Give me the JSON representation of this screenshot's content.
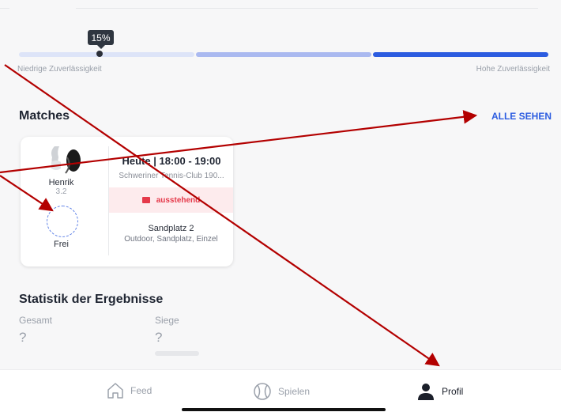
{
  "reliability": {
    "badge": "15%",
    "progress_percent": 15,
    "low_label": "Niedrige Zuverlässigkeit",
    "high_label": "Hohe Zuverlässigkeit"
  },
  "matches": {
    "title": "Matches",
    "see_all": "ALLE SEHEN",
    "card": {
      "player_name": "Henrik",
      "player_rating": "3.2",
      "free_slot_label": "Frei",
      "time": "Heute | 18:00 - 19:00",
      "club": "Schweriner Tennis-Club 190...",
      "status": "ausstehend",
      "court": "Sandplatz 2",
      "court_details": "Outdoor, Sandplatz, Einzel"
    }
  },
  "stats": {
    "title": "Statistik der Ergebnisse",
    "total_label": "Gesamt",
    "total_value": "?",
    "wins_label": "Siege",
    "wins_value": "?"
  },
  "tabbar": {
    "feed": "Feed",
    "spielen": "Spielen",
    "profil": "Profil"
  },
  "colors": {
    "accent": "#2c5ce0",
    "status_red": "#e5394a",
    "annotation_arrow": "#b30000"
  }
}
